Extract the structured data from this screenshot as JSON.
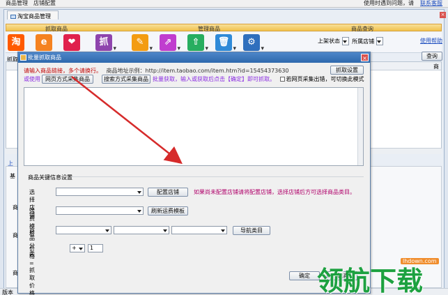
{
  "menubar": {
    "item1": "商品管理",
    "item2": "店铺配置",
    "help_text": "使用时遇到问题，请",
    "help_link": "联系客服"
  },
  "app": {
    "tab_label": "淘宝商品管理",
    "close_label": "×",
    "sections": {
      "grab": "抓取商品",
      "manage": "管理商品",
      "query": "商品查询"
    },
    "toolbar_icons": [
      {
        "name": "taobao-icon",
        "glyph": "淘",
        "color": "#ff5a00"
      },
      {
        "name": "alibaba-icon",
        "glyph": "e",
        "color": "#f58220"
      },
      {
        "name": "heart-icon",
        "glyph": "❤",
        "color": "#e0214d"
      },
      {
        "name": "grab-icon",
        "glyph": "抓",
        "color": "#8e44ad"
      },
      {
        "name": "edit-icon",
        "glyph": "✎",
        "color": "#f39c12"
      },
      {
        "name": "export-icon",
        "glyph": "⇗",
        "color": "#c03dcf"
      },
      {
        "name": "upload-icon",
        "glyph": "⇧",
        "color": "#27ae60"
      },
      {
        "name": "delete-icon",
        "glyph": "🗑",
        "color": "#2f8ad8"
      },
      {
        "name": "settings-icon",
        "glyph": "⚙",
        "color": "#2f6fbd"
      }
    ],
    "dropdown_marker": "▾",
    "query": {
      "status_label": "上架状态",
      "shop_label": "所属店铺",
      "help_link": "使用帮助",
      "query_button": "查询",
      "grab_label": "抓取"
    },
    "grid_col": "商",
    "side": {
      "a": "上",
      "b": "基",
      "c": "商",
      "d": "商",
      "e": "商",
      "version": "版本"
    }
  },
  "dialog": {
    "title": "批量抓取商品",
    "close": "×",
    "instr1": "请输入商品链接，多个请换行。",
    "instr1_example": "商品地址示例：http://item.taobao.com/item.htm?id=15454373630",
    "grab_settings_button": "抓取设置",
    "or_use": "或使用",
    "web_collect_button": "网页方式采集商品",
    "search_collect_button": "搜索方式采集商品",
    "batch_note": "批量获取，输入或获取后点击【确定】即可抓取。",
    "retry_label": "若网页采集出错，可切换此模式",
    "url_value": "",
    "settings_group": "商品关键信息设置",
    "shop_label": "选择店铺",
    "config_shop_button": "配置店铺",
    "shop_note": "如果尚未配置店铺请将配置店铺，选择店铺后方可选择商品类目。",
    "freight_label": "运费模板",
    "refresh_freight_button": "刷新运费模板",
    "category_label": "商品分类",
    "import_category_button": "导航类目",
    "price_label": "价格=抓取价格",
    "price_op": "+",
    "price_value": "1",
    "ok_button": "确定",
    "cancel_button": "取消"
  },
  "watermark": {
    "host": "lhdown.com",
    "text": "领航下载"
  }
}
